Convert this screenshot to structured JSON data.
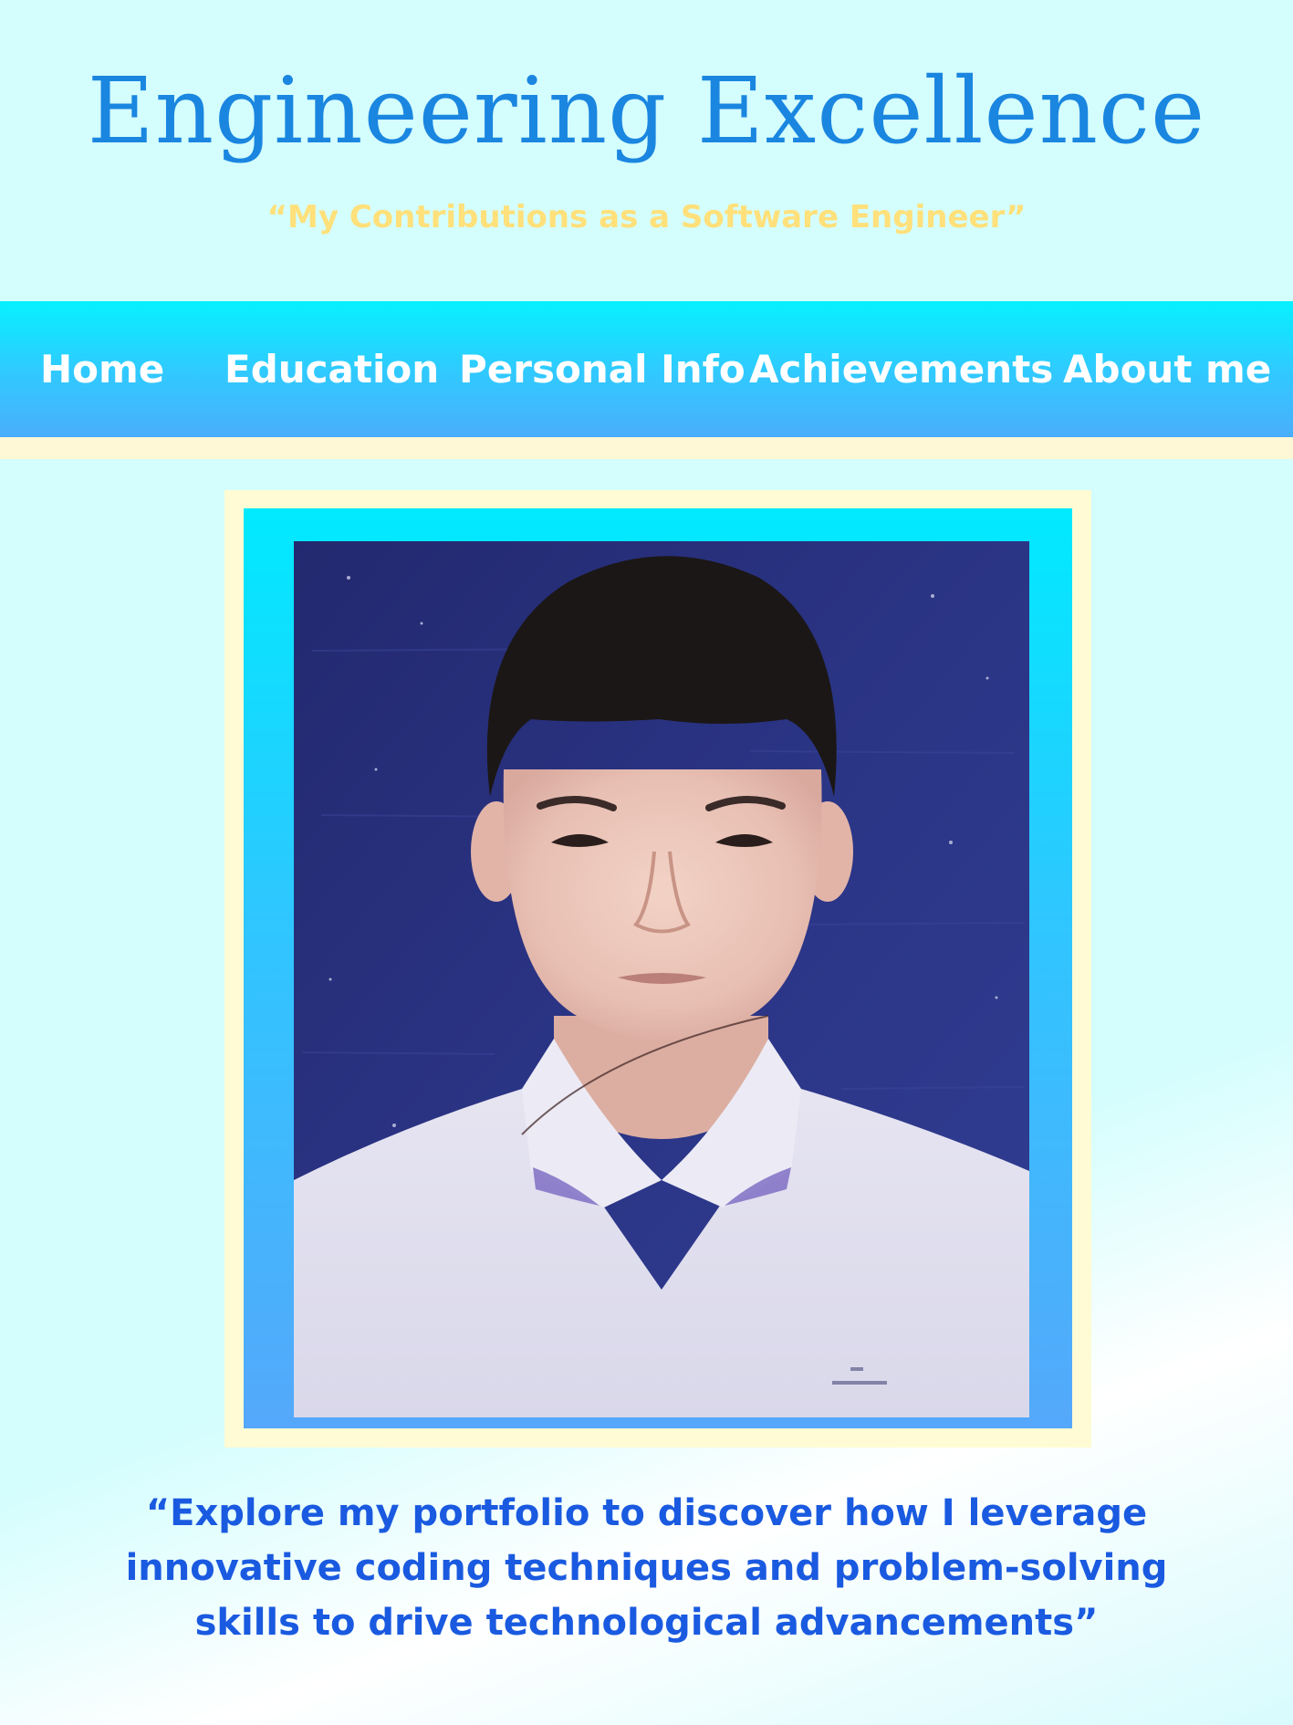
{
  "header": {
    "title": "Engineering Excellence",
    "subtitle": "“My Contributions as a Software Engineer”"
  },
  "nav": {
    "items": [
      {
        "label": "Home"
      },
      {
        "label": "Education"
      },
      {
        "label": "Personal Info"
      },
      {
        "label": "Achievements"
      },
      {
        "label": "About me"
      }
    ]
  },
  "portrait": {
    "icon": "profile-photo"
  },
  "tagline": {
    "text": "“Explore my portfolio to discover how I leverage innovative coding techniques and problem-solving skills to drive technological advancements”"
  },
  "colors": {
    "title": "#1a86e0",
    "subtitle": "#ffe07a",
    "nav_top": "#06f1ff",
    "nav_bottom": "#4aaefc",
    "tagline": "#1a5ae0",
    "background": "#d4fdfd",
    "frame": "#fffbd4"
  }
}
